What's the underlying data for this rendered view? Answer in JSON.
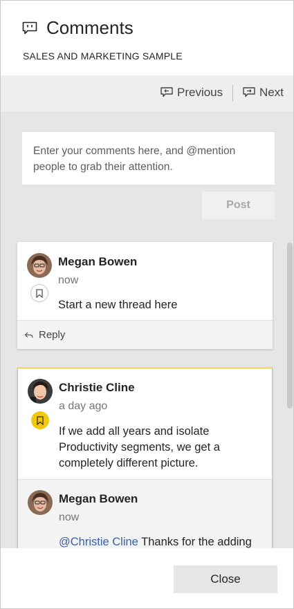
{
  "header": {
    "title": "Comments",
    "subtitle": "SALES AND MARKETING SAMPLE",
    "icon": "comment-icon"
  },
  "nav": {
    "previous_label": "Previous",
    "next_label": "Next"
  },
  "composer": {
    "placeholder": "Enter your comments here, and @mention people to grab their attention.",
    "post_label": "Post"
  },
  "threads": [
    {
      "author": "Megan Bowen",
      "time": "now",
      "text": "Start a new thread here",
      "bookmark": "bookmark-outline-icon",
      "reply_label": "Reply"
    },
    {
      "author": "Christie Cline",
      "time": "a day ago",
      "text": "If we add all years and isolate Productivity segments, we get a completely different picture.",
      "bookmark": "bookmark-filled-icon",
      "reply": {
        "author": "Megan Bowen",
        "time": "now",
        "mention": "@Christie Cline",
        "text": " Thanks for the adding"
      }
    }
  ],
  "footer": {
    "close_label": "Close"
  },
  "colors": {
    "highlight_border": "#e8c441",
    "bookmark_yellow": "#f2c80f",
    "mention_blue": "#3a5fa8",
    "panel_gray": "#e6e6e6"
  }
}
